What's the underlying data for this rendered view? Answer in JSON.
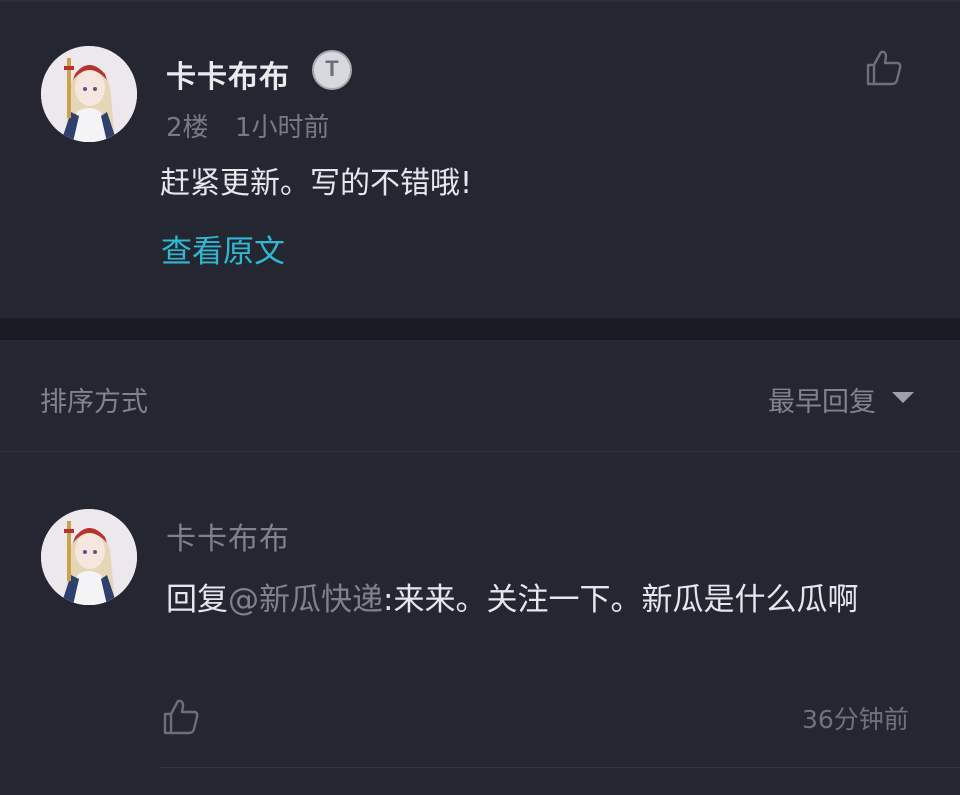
{
  "main_comment": {
    "username": "卡卡布布",
    "badge_letter": "T",
    "floor": "2楼",
    "time": "1小时前",
    "text": "赶紧更新。写的不错哦!",
    "view_original": "查看原文",
    "like_icon": "thumbs-up-icon"
  },
  "sort_bar": {
    "label": "排序方式",
    "selected": "最早回复",
    "caret_icon": "caret-down-icon"
  },
  "reply": {
    "username": "卡卡布布",
    "prefix": "回复",
    "mention": "@新瓜快递",
    "separator": ":",
    "body": "来来。关注一下。新瓜是什么瓜啊",
    "time": "36分钟前",
    "like_icon": "thumbs-up-icon"
  },
  "colors": {
    "background": "#242631",
    "accent_link": "#2eb9d1",
    "text_primary": "#e6e6ec",
    "text_muted": "#7f818c"
  }
}
